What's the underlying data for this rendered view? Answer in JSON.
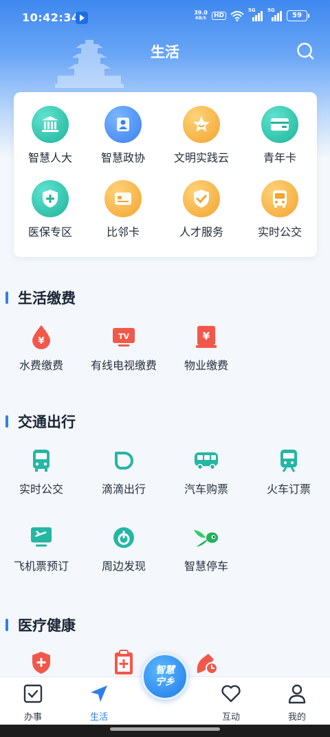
{
  "status_bar": {
    "time": "10:42:34",
    "speed_value": "39.0",
    "speed_unit": "KB/S",
    "hd": "HD",
    "signal1": "5G",
    "signal2": "5G",
    "battery": "59"
  },
  "header": {
    "title": "生活"
  },
  "quick_grid": [
    {
      "label": "智慧人大",
      "icon": "building-icon",
      "color": "teal"
    },
    {
      "label": "智慧政协",
      "icon": "person-icon",
      "color": "blue"
    },
    {
      "label": "文明实践云",
      "icon": "star-icon",
      "color": "orange"
    },
    {
      "label": "青年卡",
      "icon": "card-icon",
      "color": "teal"
    },
    {
      "label": "医保专区",
      "icon": "shield-plus-icon",
      "color": "teal"
    },
    {
      "label": "比邻卡",
      "icon": "card-icon",
      "color": "orange"
    },
    {
      "label": "人才服务",
      "icon": "shield-check-icon",
      "color": "orange"
    },
    {
      "label": "实时公交",
      "icon": "bus-icon",
      "color": "orange"
    }
  ],
  "sections": {
    "payment": {
      "title": "生活缴费",
      "items": [
        {
          "label": "水费缴费",
          "icon": "water-drop-yuan-icon"
        },
        {
          "label": "有线电视缴费",
          "icon": "tv-icon"
        },
        {
          "label": "物业缴费",
          "icon": "property-yuan-icon"
        }
      ]
    },
    "transport": {
      "title": "交通出行",
      "items": [
        {
          "label": "实时公交",
          "icon": "bus-icon"
        },
        {
          "label": "滴滴出行",
          "icon": "didi-icon"
        },
        {
          "label": "汽车购票",
          "icon": "coach-icon"
        },
        {
          "label": "火车订票",
          "icon": "train-icon"
        },
        {
          "label": "飞机票预订",
          "icon": "plane-icon"
        },
        {
          "label": "周边发现",
          "icon": "compass-icon"
        },
        {
          "label": "智慧停车",
          "icon": "parking-icon"
        }
      ]
    },
    "medical": {
      "title": "医疗健康",
      "items": [
        {
          "label": "",
          "icon": "shield-plus-icon"
        },
        {
          "label": "",
          "icon": "clipboard-icon"
        },
        {
          "label": "",
          "icon": "calendar-clock-icon"
        }
      ]
    }
  },
  "bottom_nav": {
    "items": [
      {
        "label": "办事",
        "icon": "checkbox-icon"
      },
      {
        "label": "生活",
        "icon": "navigation-arrow-icon"
      },
      {
        "label": "互动",
        "icon": "heart-icon"
      },
      {
        "label": "我的",
        "icon": "user-icon"
      }
    ],
    "center_line1": "智慧",
    "center_line2": "宁乡"
  },
  "colors": {
    "accent": "#2f7fe8",
    "teal": "#1fb39a",
    "orange": "#f2a52e",
    "red": "#f2584a"
  }
}
